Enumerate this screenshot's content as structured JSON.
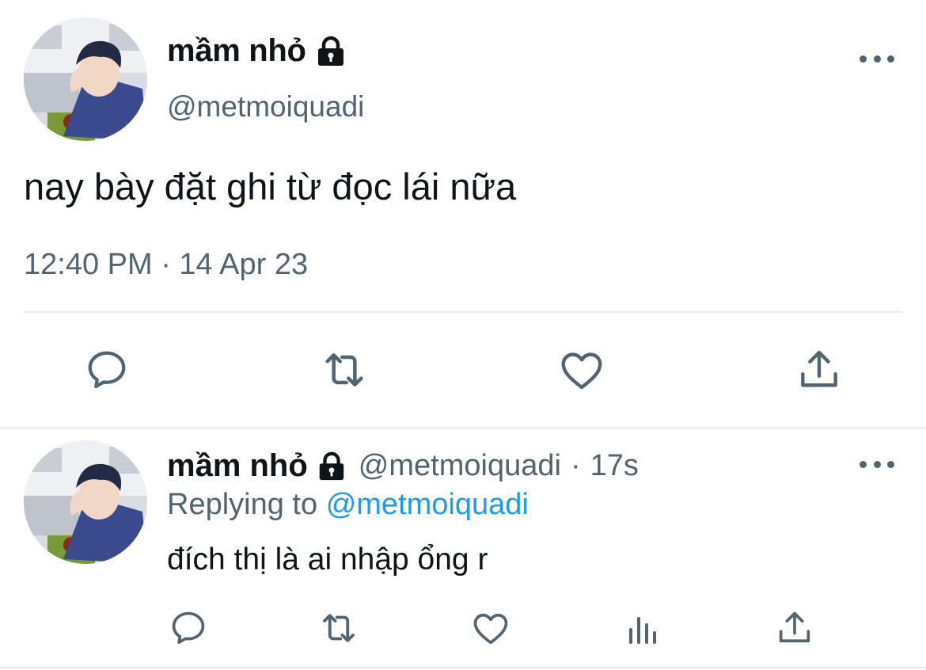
{
  "main_tweet": {
    "author": {
      "display_name": "mầm nhỏ",
      "handle": "@metmoiquadi",
      "verified_icon": "lock-icon"
    },
    "text": "nay bày đặt ghi từ đọc lái nữa",
    "timestamp": "12:40 PM · 14 Apr 23",
    "actions": [
      "reply-icon",
      "retweet-icon",
      "like-icon",
      "share-icon"
    ]
  },
  "reply_tweet": {
    "author": {
      "display_name": "mầm nhỏ",
      "handle": "@metmoiquadi",
      "verified_icon": "lock-icon"
    },
    "time_sep": "·",
    "age": "17s",
    "replying_prefix": "Replying to",
    "replying_to": "@metmoiquadi",
    "text": "đích thị là ai nhập ổng r",
    "actions": [
      "reply-icon",
      "retweet-icon",
      "like-icon",
      "analytics-icon",
      "share-icon"
    ]
  },
  "colors": {
    "text_primary": "#0f1419",
    "text_secondary": "#536471",
    "link": "#1d9bf0",
    "divider": "#e7e9ea",
    "avatar_jacket": "#3a4a8f"
  }
}
